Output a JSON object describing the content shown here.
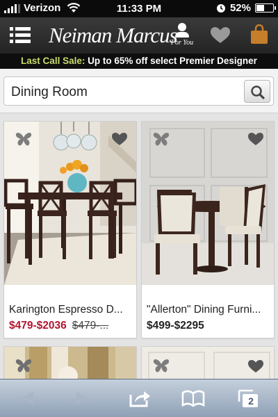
{
  "status_bar": {
    "carrier": "Verizon",
    "time": "11:33 PM",
    "battery_percent": "52%",
    "battery_level": 0.52,
    "icons": [
      "signal-bars-icon",
      "wifi-icon",
      "lock-rotation-icon",
      "battery-icon"
    ]
  },
  "header": {
    "logo": "Neiman Marcus",
    "for_you_label": "For You",
    "icons": [
      "menu-icon",
      "user-icon",
      "heart-icon",
      "shopping-bag-icon"
    ],
    "colors": {
      "bar": "#2e2e2e",
      "bag": "#c57e29"
    }
  },
  "promo": {
    "highlight": "Last Call Sale:",
    "text": " Up to 65% off select Premier Designer",
    "highlight_color": "#c9dd6c"
  },
  "search": {
    "value": "Dining Room",
    "button_icon": "magnifier-icon"
  },
  "products": [
    {
      "name": "Karington Espresso D...",
      "price": "$479-$2036",
      "original_price": "$479-...",
      "on_sale": true,
      "price_color": "#b3152f"
    },
    {
      "name": "\"Allerton\" Dining Furni...",
      "price": "$499-$2295",
      "original_price": "",
      "on_sale": false
    },
    {
      "name": "",
      "price": ""
    },
    {
      "name": "",
      "price": ""
    }
  ],
  "card_icons": [
    "butterfly-icon",
    "heart-icon"
  ],
  "toolbar": {
    "tab_count": "2",
    "icons": [
      "back-arrow-icon",
      "forward-arrow-icon",
      "share-icon",
      "bookmarks-icon",
      "tabs-icon"
    ]
  }
}
